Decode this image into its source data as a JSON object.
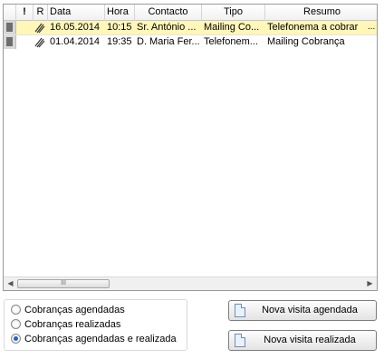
{
  "grid": {
    "columns": {
      "flag": "!",
      "read": "R",
      "data": "Data",
      "hora": "Hora",
      "contacto": "Contacto",
      "tipo": "Tipo",
      "resumo": "Resumo"
    },
    "rows": [
      {
        "data": "16.05.2014",
        "hora": "10:15",
        "contacto": "Sr. António ...",
        "tipo": "Mailing Co...",
        "resumo": "Telefonema a cobrar",
        "more": "...",
        "selected": true
      },
      {
        "data": "01.04.2014",
        "hora": "19:35",
        "contacto": "D. Maria Fer...",
        "tipo": "Telefonem...",
        "resumo": "Mailing Cobrança",
        "more": "",
        "selected": false
      }
    ],
    "scroll_thumb_glyph": "III"
  },
  "filter": {
    "options": [
      {
        "label": "Cobranças agendadas",
        "checked": false
      },
      {
        "label": "Cobranças realizadas",
        "checked": false
      },
      {
        "label": "Cobranças agendadas e realizada",
        "checked": true
      }
    ]
  },
  "actions": {
    "new_scheduled": "Nova visita agendada",
    "new_done": "Nova visita realizada",
    "icon": "document-icon"
  },
  "colors": {
    "selected_row": "#fff6b8",
    "radio_accent": "#1f63c4"
  }
}
